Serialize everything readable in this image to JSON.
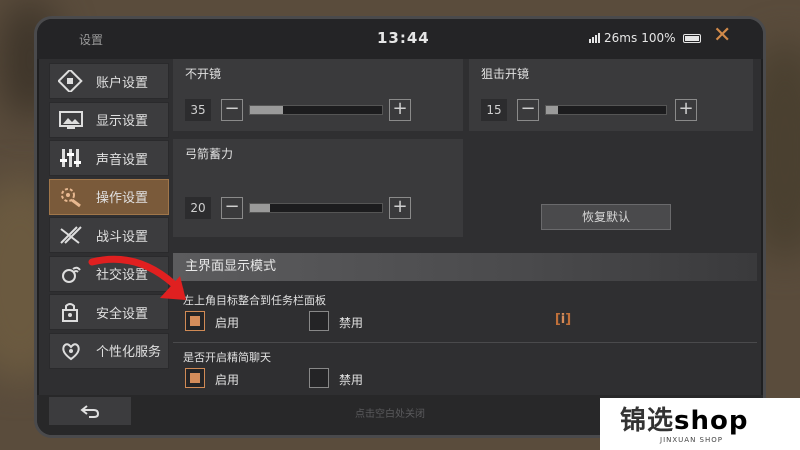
{
  "window": {
    "title": "设置",
    "clock": "13:44",
    "ping": "26ms",
    "battery": "100%"
  },
  "sidebar": {
    "items": [
      {
        "label": "账户设置",
        "icon": "account-icon",
        "active": false
      },
      {
        "label": "显示设置",
        "icon": "display-icon",
        "active": false
      },
      {
        "label": "声音设置",
        "icon": "sound-icon",
        "active": false
      },
      {
        "label": "操作设置",
        "icon": "control-icon",
        "active": true
      },
      {
        "label": "战斗设置",
        "icon": "battle-icon",
        "active": false
      },
      {
        "label": "社交设置",
        "icon": "social-icon",
        "active": false
      },
      {
        "label": "安全设置",
        "icon": "security-icon",
        "active": false
      },
      {
        "label": "个性化服务",
        "icon": "personalize-icon",
        "active": false
      }
    ]
  },
  "sliders": {
    "no_scope": {
      "label": "不开镜",
      "value": "35",
      "fill_fraction": 0.25
    },
    "sniper_scope": {
      "label": "狙击开镜",
      "value": "15",
      "fill_fraction": 0.1
    },
    "bow_charge": {
      "label": "弓箭蓄力",
      "value": "20",
      "fill_fraction": 0.15
    }
  },
  "reset_label": "恢复默认",
  "section": {
    "title": "主界面显示模式",
    "option1": {
      "label": "左上角目标整合到任务栏面板",
      "enable": "启用",
      "disable": "禁用",
      "selected": "enable"
    },
    "option2": {
      "label": "是否开启精简聊天",
      "enable": "启用",
      "disable": "禁用",
      "selected": "enable"
    },
    "info_glyph": "i"
  },
  "footer": {
    "hint": "点击空白处关闭"
  },
  "watermark": {
    "main": "锦选",
    "shop": "shop",
    "sub": "JINXUAN SHOP"
  },
  "colors": {
    "accent": "#d48c5a",
    "active_tab": "#7a5a3a",
    "arrow": "#e02020"
  }
}
